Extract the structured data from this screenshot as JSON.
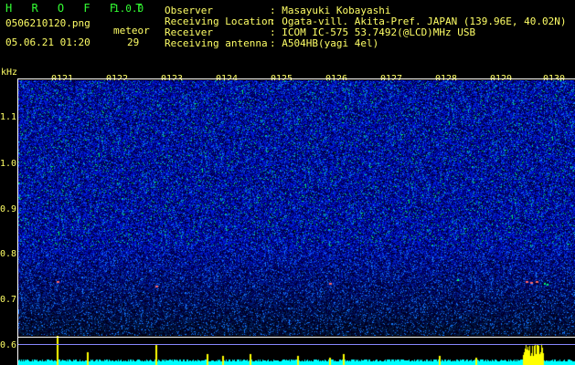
{
  "app": {
    "title": "H R O F F T",
    "version": "1.0.0"
  },
  "file": {
    "name": "0506210120.png",
    "datetime": "05.06.21 01:20"
  },
  "meteor": {
    "label": "meteor",
    "count": "29"
  },
  "info": [
    {
      "label": "Observer",
      "value": ": Masayuki Kobayashi"
    },
    {
      "label": "Receiving Location",
      "value": ": Ogata-vill. Akita-Pref. JAPAN (139.96E, 40.02N)"
    },
    {
      "label": "Receiver",
      "value": ": ICOM IC-575 53.7492(@LCD)MHz USB"
    },
    {
      "label": "Receiving antenna",
      "value": ": A504HB(yagi 4el)"
    }
  ],
  "yaxis": {
    "unit": "kHz",
    "ticks": [
      "1.1",
      "1.0",
      "0.9",
      "0.8",
      "0.7",
      "0.6"
    ]
  },
  "xaxis": {
    "ticks": [
      "0121",
      "0122",
      "0123",
      "0124",
      "0125",
      "0126",
      "0127",
      "0128",
      "0129",
      "0130"
    ]
  },
  "colors": {
    "text": "#ffff66",
    "title": "#33ff33",
    "axis": "#ffffff",
    "level": "#00ffff",
    "spike": "#ffff00"
  }
}
